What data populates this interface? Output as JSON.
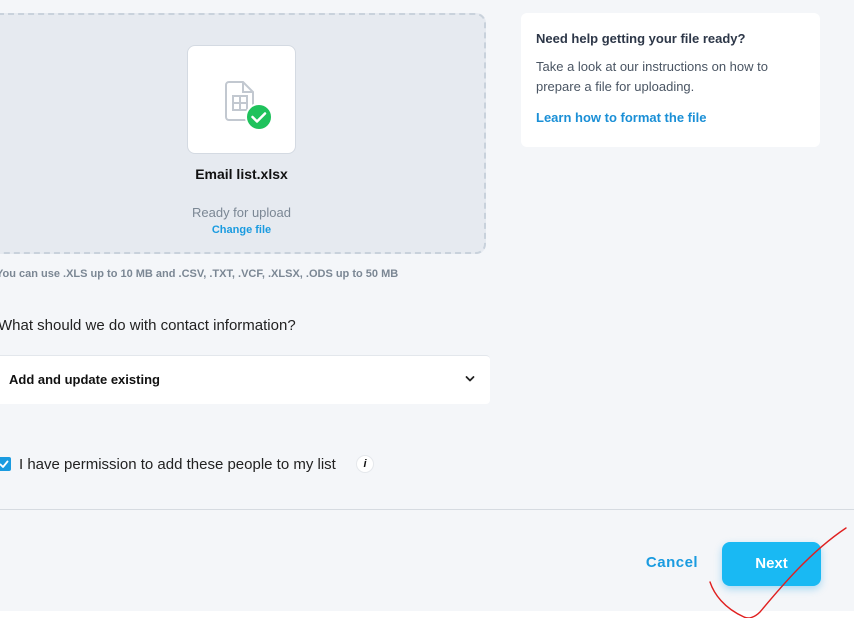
{
  "upload": {
    "file_name": "Email list.xlsx",
    "status": "Ready for upload",
    "change_link": "Change file",
    "file_icon": "spreadsheet-file-icon",
    "success_icon": "check-circle-icon"
  },
  "limits_text": "You can use .XLS up to 10 MB and .CSV, .TXT, .VCF, .XLSX, .ODS up to 50 MB",
  "contact_question": "What should we do with contact information?",
  "contact_select": {
    "value": "Add and update existing",
    "icon": "chevron-down-icon"
  },
  "permission": {
    "checked": true,
    "label": "I have permission to add these people to my list",
    "info_icon": "i"
  },
  "help": {
    "title": "Need help getting your file ready?",
    "text": "Take a look at our instructions on how to prepare a file for uploading.",
    "link": "Learn how to format the file"
  },
  "footer": {
    "cancel_label": "Cancel",
    "next_label": "Next"
  },
  "colors": {
    "accent": "#1a9be0",
    "next_button": "#19b9f3",
    "success": "#1fc25c",
    "annotation": "#e02020"
  }
}
